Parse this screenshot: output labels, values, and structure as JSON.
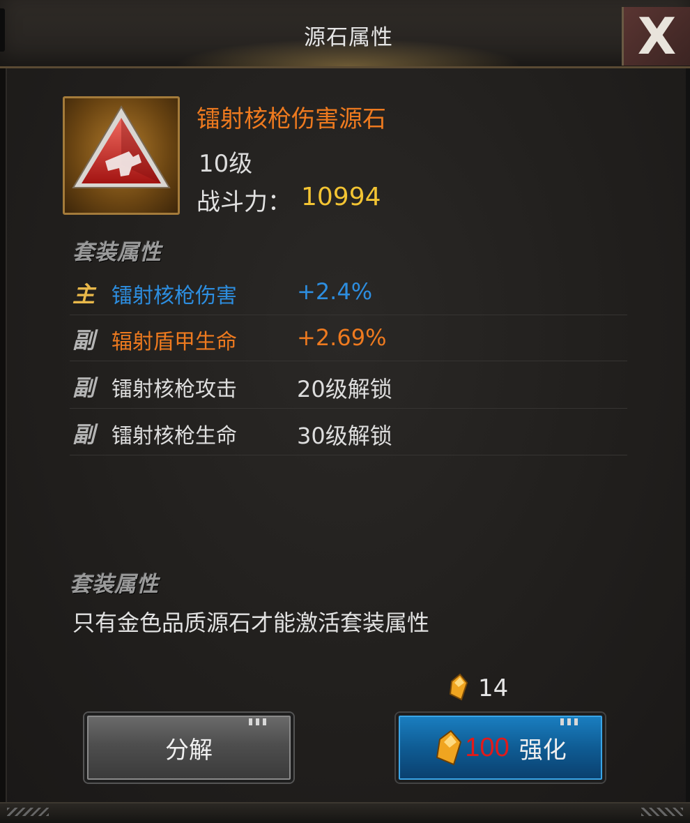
{
  "dialog": {
    "title": "源石属性",
    "close_label": "X"
  },
  "item": {
    "name": "镭射核枪伤害源石",
    "level": "10级",
    "power_label": "战斗力：",
    "power_value": "10994",
    "icon": "red-triangle-gun-stone-icon"
  },
  "attributes": {
    "section_title": "套装属性",
    "rows": [
      {
        "tag": "主",
        "name": "镭射核枪伤害",
        "value": "+2.4%"
      },
      {
        "tag": "副",
        "name": "辐射盾甲生命",
        "value": "+2.69%"
      },
      {
        "tag": "副",
        "name": "镭射核枪攻击",
        "value": "20级解锁"
      },
      {
        "tag": "副",
        "name": "镭射核枪生命",
        "value": "30级解锁"
      }
    ]
  },
  "set_bonus": {
    "section_title": "套装属性",
    "description": "只有金色品质源石才能激活套装属性"
  },
  "currency": {
    "owned": "14",
    "icon": "gold-gem-icon"
  },
  "buttons": {
    "decompose_label": "分解",
    "enhance_cost": "100",
    "enhance_label": "强化"
  },
  "colors": {
    "accent_orange": "#ee7a1f",
    "accent_blue": "#2d8ee0",
    "power_gold": "#f3c433",
    "cost_red": "#e21a1a"
  }
}
